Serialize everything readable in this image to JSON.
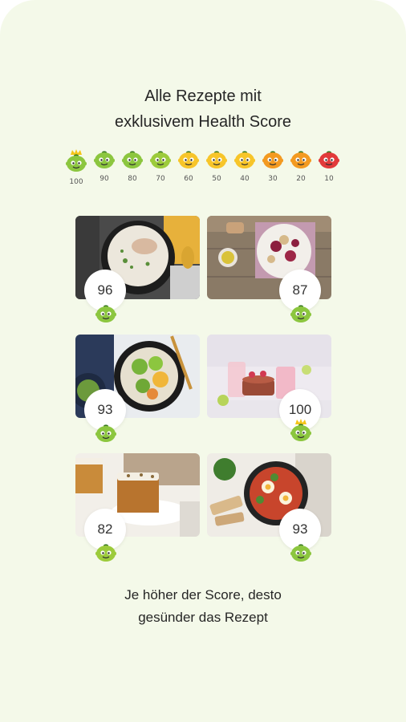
{
  "headline": {
    "line1": "Alle Rezepte mit",
    "line2": "exklusivem Health Score"
  },
  "scale": [
    {
      "label": "100",
      "color": "#8cc63f",
      "crown": true
    },
    {
      "label": "90",
      "color": "#8cc63f",
      "crown": false
    },
    {
      "label": "80",
      "color": "#8cc63f",
      "crown": false
    },
    {
      "label": "70",
      "color": "#9ccb3b",
      "crown": false
    },
    {
      "label": "60",
      "color": "#f7c52a",
      "crown": false
    },
    {
      "label": "50",
      "color": "#f7c52a",
      "crown": false
    },
    {
      "label": "40",
      "color": "#f7c52a",
      "crown": false
    },
    {
      "label": "30",
      "color": "#f39a21",
      "crown": false
    },
    {
      "label": "20",
      "color": "#f39a21",
      "crown": false
    },
    {
      "label": "10",
      "color": "#e23a3a",
      "crown": false
    }
  ],
  "recipes": [
    {
      "score": "96",
      "image": "rice-bowl-photo"
    },
    {
      "score": "87",
      "image": "beet-salad-photo"
    },
    {
      "score": "93",
      "image": "buddha-bowl-photo"
    },
    {
      "score": "100",
      "image": "berry-drinks-photo"
    },
    {
      "score": "82",
      "image": "carrot-cake-photo"
    },
    {
      "score": "93",
      "image": "shakshuka-photo"
    }
  ],
  "footer": {
    "line1": "Je höher der Score, desto",
    "line2": "gesünder das Rezept"
  }
}
